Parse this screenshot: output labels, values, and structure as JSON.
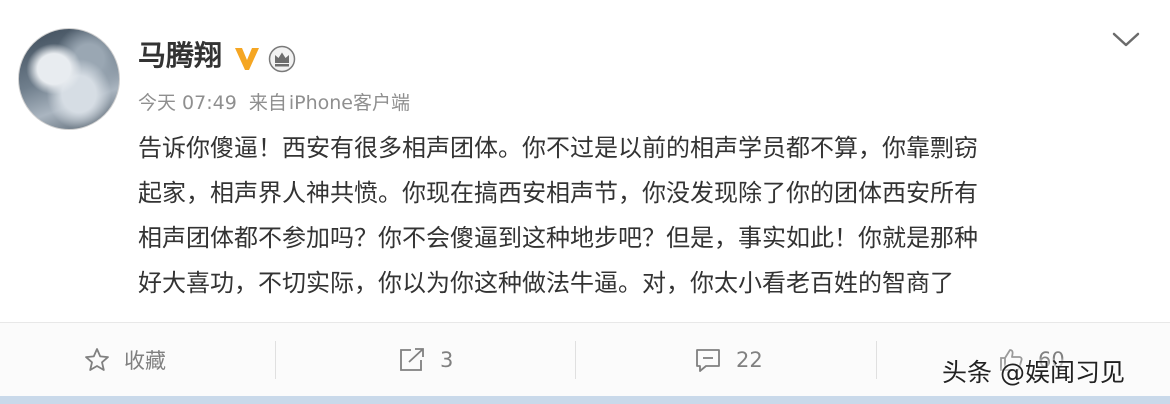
{
  "user": {
    "name": "马腾翔",
    "avatar_icon": "avatar-landscape",
    "verified_badge_color": "#f5a623"
  },
  "meta": {
    "time": "今天 07:49",
    "source_prefix": "来自",
    "source": "iPhone客户端"
  },
  "post": {
    "lines": [
      "告诉你傻逼！西安有很多相声团体。你不过是以前的相声学员都不算，你靠剽窃",
      "起家，相声界人神共愤。你现在搞西安相声节，你没发现除了你的团体西安所有",
      "相声团体都不参加吗？你不会傻逼到这种地步吧？但是，事实如此！你就是那种",
      "好大喜功，不切实际，你以为你这种做法牛逼。对，你太小看老百姓的智商了"
    ]
  },
  "actions": {
    "favorite_label": "收藏",
    "repost_count": "3",
    "comment_count": "22",
    "like_count": "60"
  },
  "watermark": "头条 @娱闻习见"
}
